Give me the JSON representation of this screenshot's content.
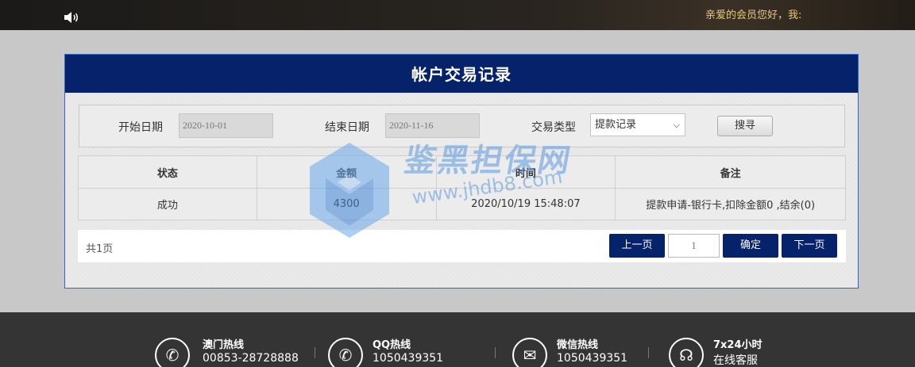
{
  "topbar": {
    "welcome": "亲爱的会员您好，我: "
  },
  "panel": {
    "title": "帐户交易记录",
    "filters": {
      "start_label": "开始日期",
      "start_value": "2020-10-01",
      "end_label": "结束日期",
      "end_value": "2020-11-16",
      "type_label": "交易类型",
      "type_value": "提款记录",
      "search_label": "搜寻"
    },
    "table": {
      "headers": [
        "状态",
        "金额",
        "时间",
        "备注"
      ],
      "rows": [
        {
          "status": "成功",
          "amount": "4300",
          "time": "2020/10/19 15:48:07",
          "note": "提款申请-银行卡,扣除金额0 ,结余(0)"
        }
      ]
    },
    "pager": {
      "total": "共1页",
      "prev": "上一页",
      "page": "1",
      "confirm": "确定",
      "next": "下一页"
    }
  },
  "watermark": {
    "line1": "鉴黑担保网",
    "line2": "www.jhdb8.com"
  },
  "footer": {
    "items": [
      {
        "icon": "phone-icon",
        "title": "澳门热线",
        "value": "00853-28728888"
      },
      {
        "icon": "phone-icon",
        "title": "QQ热线",
        "value": "1050439351"
      },
      {
        "icon": "mail-icon",
        "title": "微信热线",
        "value": "1050439351"
      },
      {
        "icon": "headset-icon",
        "title": "7x24小时",
        "value": "在线客服"
      }
    ]
  },
  "colors": {
    "header_bg": "#05226b",
    "status_success": "#3a8a2a",
    "footer_bg": "#343434"
  }
}
